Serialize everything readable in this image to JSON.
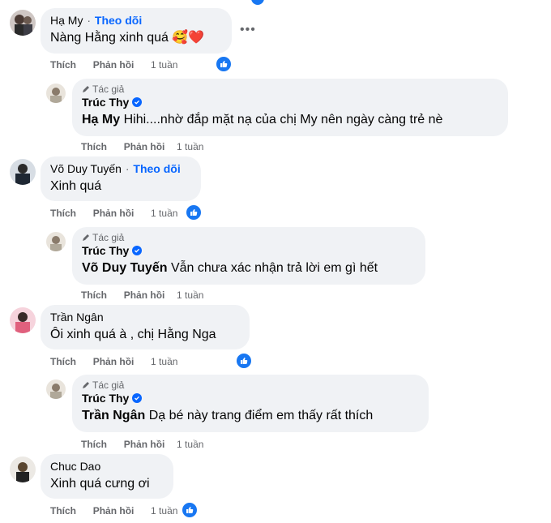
{
  "comments": [
    {
      "author": "Hạ My",
      "follow": "Theo dõi",
      "text": "Nàng Hằng xinh quá",
      "emoji": "🥰❤️",
      "actions": {
        "like": "Thích",
        "reply": "Phản hồi",
        "time": "1 tuần"
      },
      "reply": {
        "tag": "Tác giả",
        "author": "Trúc Thy",
        "mention": "Hạ My",
        "text": "Hihi....nhờ đắp mặt nạ của chị My nên ngày càng trẻ nè",
        "actions": {
          "like": "Thích",
          "reply": "Phản hồi",
          "time": "1 tuần"
        }
      }
    },
    {
      "author": "Võ Duy Tuyến",
      "follow": "Theo dõi",
      "text": "Xinh quá",
      "actions": {
        "like": "Thích",
        "reply": "Phản hồi",
        "time": "1 tuần"
      },
      "reply": {
        "tag": "Tác giả",
        "author": "Trúc Thy",
        "mention": "Võ Duy Tuyến",
        "text": "Vẫn chưa xác nhận trả lời em gì hết",
        "actions": {
          "like": "Thích",
          "reply": "Phản hồi",
          "time": "1 tuần"
        }
      }
    },
    {
      "author": "Trần Ngân",
      "text": "Ôi xinh quá à , chị Hằng Nga",
      "actions": {
        "like": "Thích",
        "reply": "Phản hồi",
        "time": "1 tuần"
      },
      "reply": {
        "tag": "Tác giả",
        "author": "Trúc Thy",
        "mention": "Trần Ngân",
        "text": "Dạ bé này trang điểm em thấy rất thích",
        "actions": {
          "like": "Thích",
          "reply": "Phản hồi",
          "time": "1 tuần"
        }
      }
    },
    {
      "author": "Chuc Dao",
      "text": "Xinh quá cưng ơi",
      "actions": {
        "like": "Thích",
        "reply": "Phản hồi",
        "time": "1 tuần"
      }
    }
  ],
  "colors": {
    "accent": "#0866ff",
    "bubble": "#f0f2f5",
    "meta": "#65676b",
    "like": "#1877f2"
  },
  "icons": {
    "like": "thumbs-up-icon",
    "verified": "verified-badge-icon",
    "pen": "pen-icon",
    "more": "more-dots-icon"
  }
}
